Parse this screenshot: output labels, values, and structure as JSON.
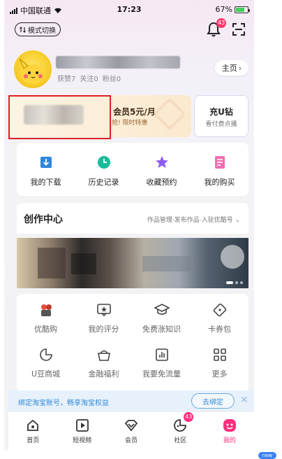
{
  "status_bar": {
    "carrier": "中国联通",
    "time": "17:23",
    "battery": "67%"
  },
  "header": {
    "mode_switch_label": "模式切换",
    "notification_count": "43"
  },
  "profile": {
    "stats_likes": "获赞7",
    "stats_follow": "关注0",
    "stats_fans": "粉丝0",
    "home_label": "主页"
  },
  "vip": {
    "title": "会员5元/月",
    "subtitle": "抢! 限时特惠",
    "topup_title": "充U钻",
    "topup_sub": "看付费点播"
  },
  "quick_actions": [
    {
      "label": "我的下载",
      "icon": "download-icon",
      "color": "#2e86de"
    },
    {
      "label": "历史记录",
      "icon": "clock-icon",
      "color": "#1abc9c"
    },
    {
      "label": "收藏预约",
      "icon": "star-icon",
      "color": "#8e5cf7"
    },
    {
      "label": "我的购买",
      "icon": "receipt-icon",
      "color": "#f06fb0"
    }
  ],
  "create_center": {
    "title": "创作中心",
    "links": "作品管理·发布作品·入驻优酷号"
  },
  "services": [
    {
      "label": "优酷购",
      "icon": "shopping-icon"
    },
    {
      "label": "我的评分",
      "icon": "rating-icon"
    },
    {
      "label": "免费涨知识",
      "icon": "graduation-cap-icon"
    },
    {
      "label": "卡券包",
      "icon": "coupon-icon"
    },
    {
      "label": "U豆商城",
      "icon": "bean-icon"
    },
    {
      "label": "金融福利",
      "icon": "wallet-icon"
    },
    {
      "label": "我要免流量",
      "icon": "data-plan-icon"
    },
    {
      "label": "更多",
      "icon": "grid-icon"
    }
  ],
  "taobao_bar": {
    "text": "绑定淘宝账号，畅享淘宝权益",
    "button": "去绑定",
    "close": "✕"
  },
  "tabs": [
    {
      "label": "首页",
      "icon": "home-icon"
    },
    {
      "label": "短视频",
      "icon": "play-icon"
    },
    {
      "label": "会员",
      "icon": "diamond-icon"
    },
    {
      "label": "社区",
      "icon": "community-icon",
      "badge": "43"
    },
    {
      "label": "我的",
      "icon": "profile-icon",
      "active": true
    }
  ],
  "corner_badge": "new",
  "colors": {
    "accent_pink": "#ff2e7e",
    "link_blue": "#2f8ad8",
    "highlight_red": "#e02020"
  }
}
